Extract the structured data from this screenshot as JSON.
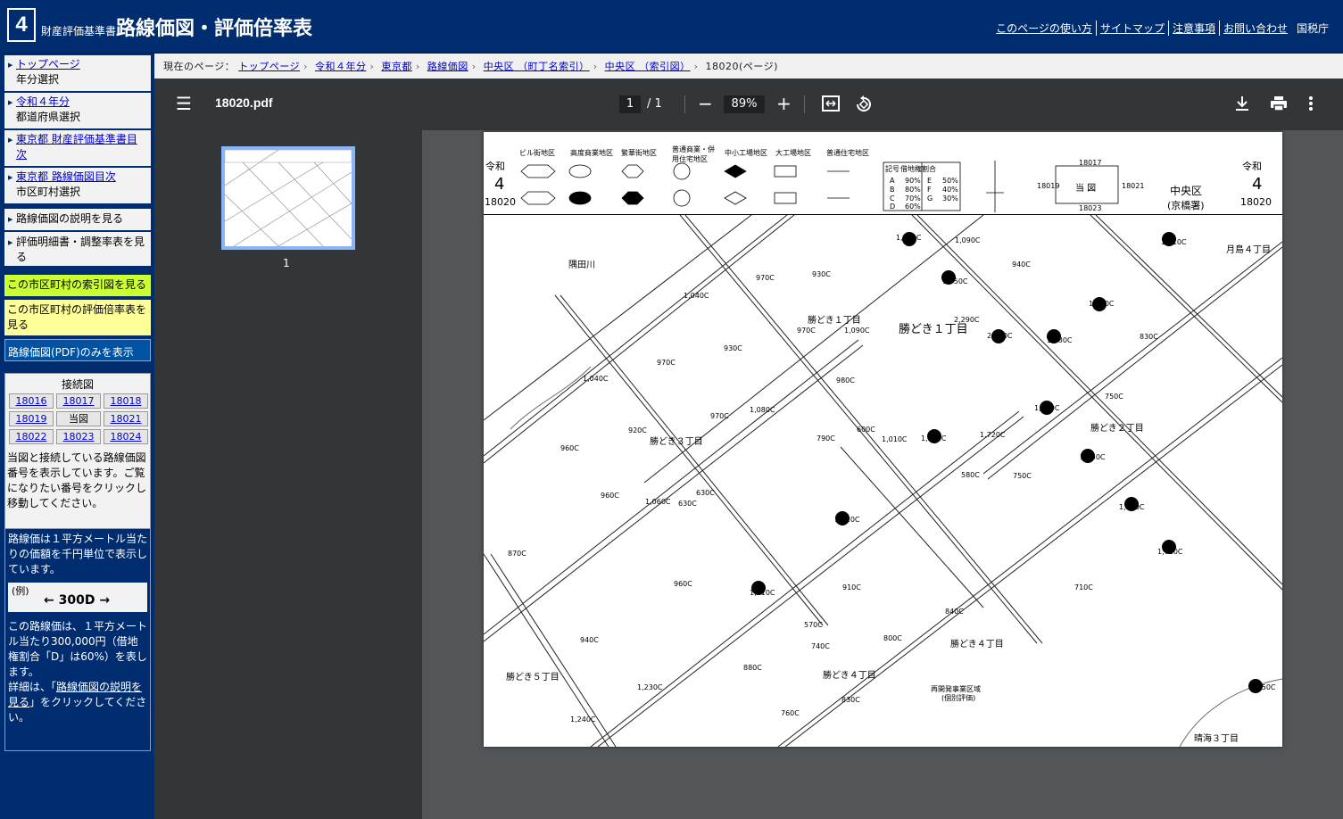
{
  "header": {
    "logo_number": "4",
    "subtitle": "財産評価基準書",
    "title": "路線価図・評価倍率表",
    "links": [
      "このページの使い方",
      "サイトマップ",
      "注意事項",
      "お問い合わせ"
    ],
    "agency": "国税庁"
  },
  "sidebar": {
    "nav": [
      {
        "link": "トップページ",
        "sub": "年分選択"
      },
      {
        "link": "令和４年分",
        "sub": "都道府県選択"
      },
      {
        "link": "東京都 財産評価基準書目次",
        "sub": ""
      },
      {
        "link": "東京都 路線価図目次",
        "sub": "市区町村選択"
      }
    ],
    "actions": [
      "路線価図の説明を見る",
      "評価明細書・調整率表を見る"
    ],
    "index_map": "この市区町村の索引図を見る",
    "multiplier": "この市区町村の評価倍率表を見る",
    "pdf_only": "路線価図(PDF)のみを表示",
    "connect": {
      "title": "接続図",
      "cells": [
        "18016",
        "18017",
        "18018",
        "18019",
        "当図",
        "18021",
        "18022",
        "18023",
        "18024"
      ],
      "desc": "当図と接続している路線価図番号を表示しています。ご覧になりたい番号をクリックし移動してください。"
    },
    "info": {
      "text1": "路線価は１平方メートル当たりの価額を千円単位で表示しています。",
      "example_label": "(例)",
      "example_value": "← 300D →",
      "text2": "この路線価は、１平方メートル当たり300,000円（借地権割合「D」は60%）を表します。",
      "text3_prefix": "詳細は、「",
      "text3_link": "路線価図の説明を見る",
      "text3_suffix": "」をクリックしてください。"
    }
  },
  "breadcrumb": {
    "label": "現在のページ：",
    "items": [
      "トップページ",
      "令和４年分",
      "東京都",
      "路線価図",
      "中央区 （町丁名索引）",
      "中央区 （索引図）"
    ],
    "current": "18020(ページ)"
  },
  "viewer": {
    "filename": "18020.pdf",
    "page_current": "1",
    "page_total": "/ 1",
    "zoom": "89%",
    "thumb_label": "1"
  },
  "map": {
    "era": "令和",
    "year": "4",
    "sheet": "18020",
    "ward": "中央区",
    "office": "(京橋署)",
    "legend_types": [
      "ビル街地区",
      "高度商業地区",
      "繁華街地区",
      "普通商業・併用住宅地区",
      "中小工場地区",
      "大工場地区",
      "普通住宅地区"
    ],
    "ratio_table": [
      [
        "記号",
        "借地権割合"
      ],
      [
        "A",
        "90%"
      ],
      [
        "B",
        "80%"
      ],
      [
        "C",
        "70%"
      ],
      [
        "D",
        "60%"
      ],
      [
        "E",
        "50%"
      ],
      [
        "F",
        "40%"
      ],
      [
        "G",
        "30%"
      ]
    ],
    "neighbors": {
      "top": "18017",
      "left": "18019",
      "center": "当 図",
      "right": "18021",
      "bottom": "18023"
    },
    "areas": [
      "勝どき１丁目",
      "勝どき１丁目",
      "勝どき２丁目",
      "勝どき３丁目",
      "勝どき４丁目",
      "勝どき４丁目",
      "勝どき５丁目",
      "月島４丁目",
      "晴海３丁目",
      "再開発事業区域",
      "(個別評価)",
      "隅田川"
    ],
    "prices": [
      "1,660C",
      "1,090C",
      "1,810C",
      "930C",
      "940C",
      "970C",
      "1,040C",
      "1,750C",
      "1,840C",
      "2,290C",
      "2,040C",
      "1,980C",
      "970C",
      "1,090C",
      "930C",
      "970C",
      "830C",
      "1,040C",
      "980C",
      "1,890C",
      "1,080C",
      "750C",
      "970C",
      "920C",
      "1,990C",
      "1,010C",
      "1,720C",
      "790C",
      "600C",
      "960C",
      "1,850C",
      "580C",
      "750C",
      "1,060C",
      "630C",
      "630C",
      "960C",
      "1,620C",
      "1,720C",
      "1,710C",
      "870C",
      "960C",
      "1,610C",
      "910C",
      "840C",
      "800C",
      "710C",
      "940C",
      "1,230C",
      "570C",
      "740C",
      "1,240C",
      "880C",
      "760C",
      "830C",
      "1,650C"
    ]
  }
}
